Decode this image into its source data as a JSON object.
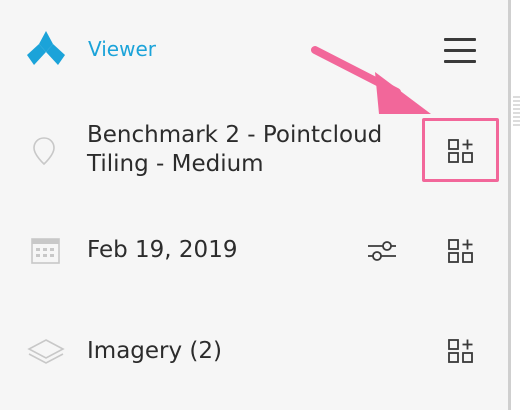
{
  "header": {
    "logo_icon": "tri-blade-logo-icon",
    "title": "Viewer",
    "menu_icon": "hamburger-menu-icon"
  },
  "rows": [
    {
      "icon": "location-pin-icon",
      "label_line1": "Benchmark 2 - Pointcloud",
      "label_line2": "Tiling - Medium",
      "action_icon": "add-widget-icon",
      "highlighted": true
    },
    {
      "icon": "calendar-icon",
      "label": "Feb 19, 2019",
      "filter_icon": "sliders-filter-icon",
      "action_icon": "add-widget-icon"
    },
    {
      "icon": "layers-icon",
      "label": "Imagery (2)",
      "action_icon": "add-widget-icon"
    }
  ],
  "annotation": {
    "color": "#f2679a",
    "icon": "pointer-arrow-icon"
  },
  "colors": {
    "accent": "#1ba3d9",
    "text": "#2c2c2c",
    "icon_gray": "#c8c8c8",
    "panel_bg": "#f6f6f6"
  }
}
